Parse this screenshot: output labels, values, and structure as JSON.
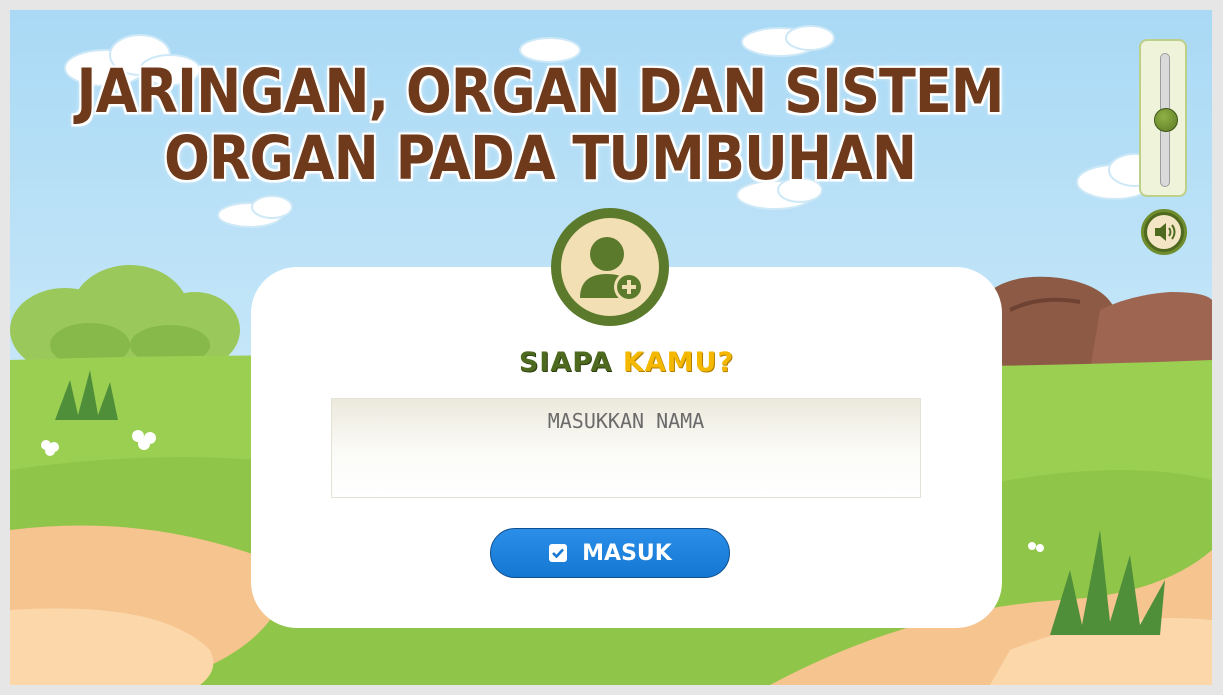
{
  "title": {
    "line1": "JARINGAN, ORGAN DAN SISTEM",
    "line2": "ORGAN PADA TUMBUHAN"
  },
  "login": {
    "prompt_part1": "SIAPA",
    "prompt_part2": "KAMU?",
    "name_placeholder": "MASUKKAN NAMA",
    "name_value": "",
    "submit_label": "MASUK"
  },
  "audio": {
    "volume_level": 0.5,
    "sound_icon": "speaker-icon"
  },
  "icons": {
    "avatar": "add-user-icon",
    "submit": "check-square-icon"
  },
  "colors": {
    "title": "#6e3a1b",
    "prompt_primary": "#4d6a1f",
    "prompt_accent": "#f5b800",
    "button": "#1a82dd",
    "avatar_ring": "#5b7a2b"
  }
}
